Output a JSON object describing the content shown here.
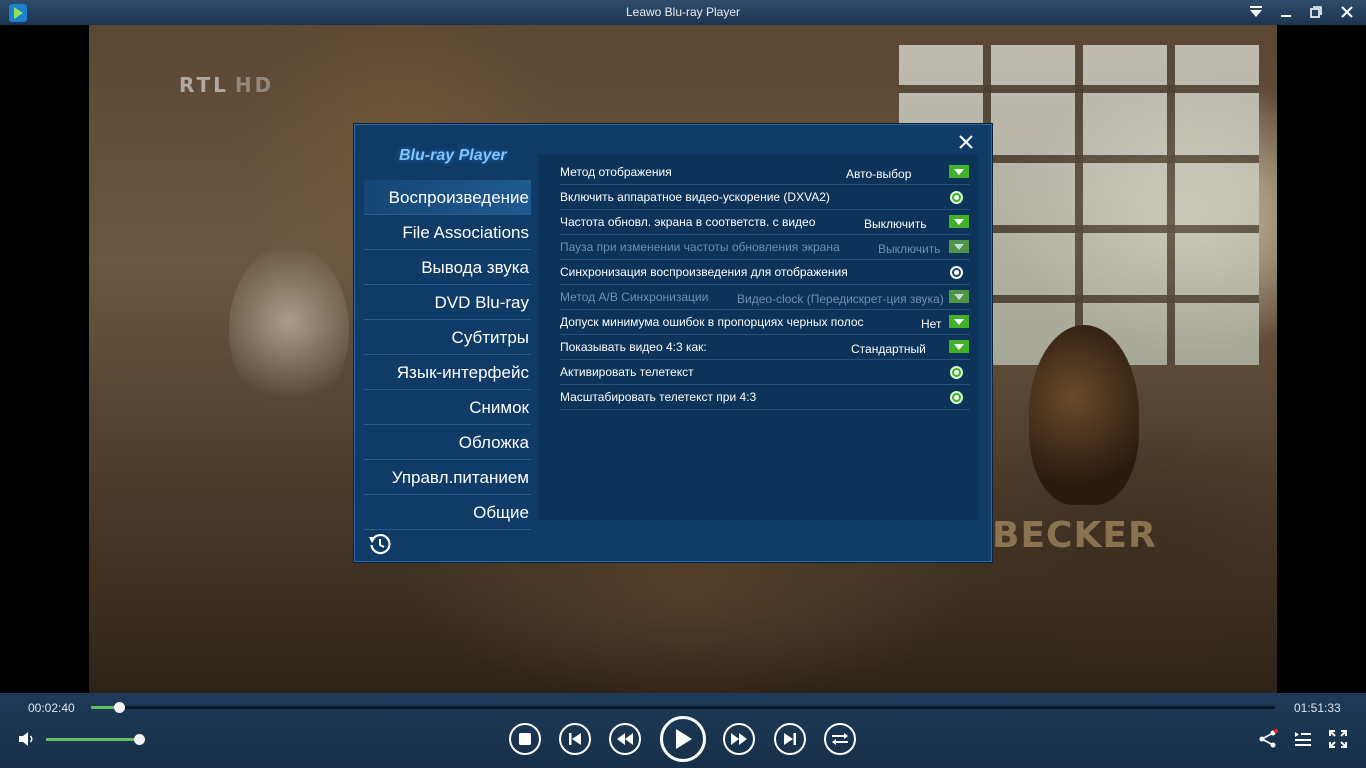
{
  "window": {
    "title": "Leawo Blu-ray Player"
  },
  "video": {
    "channel_logo": "RTL",
    "channel_logo_suffix": "HD",
    "watermark": "BECKER"
  },
  "dialog": {
    "brand": "Blu-ray Player",
    "nav": [
      {
        "label": "Воспроизведение",
        "active": true
      },
      {
        "label": "File Associations"
      },
      {
        "label": "Вывода звука"
      },
      {
        "label": "DVD  Blu-ray"
      },
      {
        "label": "Субтитры"
      },
      {
        "label": "Язык-интерфейс"
      },
      {
        "label": "Снимок"
      },
      {
        "label": "Обложка"
      },
      {
        "label": "Управл.питанием"
      },
      {
        "label": "Общие"
      }
    ],
    "settings": [
      {
        "label": "Метод отображения",
        "type": "dropdown",
        "value": "Авто-выбор",
        "enabled": true
      },
      {
        "label": "Включить аппаратное видео-ускорение  (DXVA2)",
        "type": "toggle",
        "on": true,
        "enabled": true
      },
      {
        "label": "Частота обновл. экрана в соответств. с видео",
        "type": "dropdown",
        "value": "Выключить",
        "enabled": true
      },
      {
        "label": "Пауза при изменении частоты обновления экрана",
        "type": "dropdown",
        "value": "Выключить",
        "enabled": false
      },
      {
        "label": "Синхронизация воспроизведения для отображения",
        "type": "toggle",
        "on": false,
        "enabled": true
      },
      {
        "label": "Метод A/B Синхронизации",
        "type": "dropdown",
        "value": "Видео-clock (Передискрет-ция звука)",
        "enabled": false
      },
      {
        "label": "Допуск минимума ошибок в пропорциях черных полос",
        "type": "dropdown",
        "value": "Нет",
        "enabled": true
      },
      {
        "label": "Показывать видео 4:3 как:",
        "type": "dropdown",
        "value": "Стандартный",
        "enabled": true
      },
      {
        "label": "Активировать телетекст",
        "type": "toggle",
        "on": true,
        "enabled": true
      },
      {
        "label": "Масштабировать телетекст при 4:3",
        "type": "toggle",
        "on": true,
        "enabled": true
      }
    ]
  },
  "player": {
    "elapsed": "00:02:40",
    "duration": "01:51:33",
    "progress_percent": 2.4,
    "volume_percent": 100
  },
  "colors": {
    "accent_green": "#43b02a",
    "dialog_bg": "#0f3b66",
    "controlbar_bg": "#1e3a58"
  }
}
